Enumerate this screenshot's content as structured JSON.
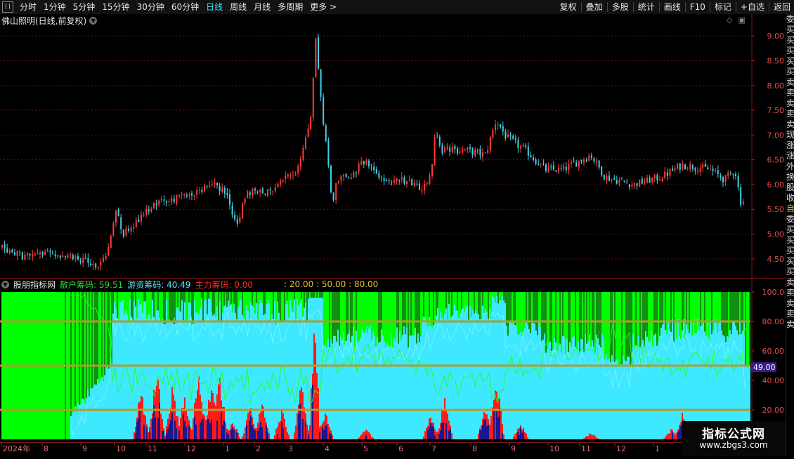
{
  "toolbar": {
    "left_items": [
      {
        "label": "分时",
        "active": false
      },
      {
        "label": "1分钟",
        "active": false
      },
      {
        "label": "5分钟",
        "active": false
      },
      {
        "label": "15分钟",
        "active": false
      },
      {
        "label": "30分钟",
        "active": false
      },
      {
        "label": "60分钟",
        "active": false
      },
      {
        "label": "日线",
        "active": true
      },
      {
        "label": "周线",
        "active": false
      },
      {
        "label": "月线",
        "active": false
      },
      {
        "label": "多周期",
        "active": false
      },
      {
        "label": "更多 >",
        "active": false
      }
    ],
    "right_items": [
      "复权",
      "叠加",
      "多股",
      "统计",
      "画线",
      "F10",
      "标记",
      "+自选",
      "返回"
    ]
  },
  "main_chart": {
    "title": "佛山照明(日线,前复权)",
    "icons": [
      "diamond-icon",
      "window-icon"
    ],
    "y_ticks": [
      "9.00",
      "8.50",
      "8.00",
      "7.50",
      "7.00",
      "6.50",
      "6.00",
      "5.50",
      "5.00",
      "4.50"
    ],
    "y_range": [
      4.2,
      9.3
    ],
    "up_color": "#ff3b3b",
    "down_color": "#3fd3e8"
  },
  "indicator": {
    "site_label": "股朋指标网",
    "retail": {
      "label": "散户筹码: 59.51",
      "color": "#27d63a"
    },
    "hot_money": {
      "label": "游资筹码: 40.49",
      "color": "#5be7ff"
    },
    "main_force": {
      "label": "主力筹码: 0.00",
      "color": "#ff2a2a"
    },
    "levels_label": ": 20.00 : 50.00 : 80.00",
    "y_ticks": [
      "100.0",
      "80.00",
      "60.00",
      "40.00",
      "20.00"
    ],
    "current_badge": "49.00",
    "y_range": [
      0,
      100
    ],
    "ref_lines": [
      20,
      50,
      80
    ],
    "colors": {
      "green": "#00ff00",
      "dark_green": "#119011",
      "cyan": "#3ee8ff",
      "blue": "#4e44c8",
      "navy": "#1a1790",
      "red": "#ff1a1a",
      "line": "#b59a2a"
    }
  },
  "date_axis": {
    "labels": [
      "2024年",
      "8",
      "9",
      "10",
      "11",
      "12",
      "1",
      "2",
      "3",
      "4",
      "5",
      "6",
      "7",
      "8",
      "9",
      "10",
      "11",
      "12",
      "1"
    ],
    "color": "#e07070"
  },
  "right_panel_chars": [
    "委",
    "买",
    "买",
    "买",
    "买",
    "买",
    "卖",
    "卖",
    "卖",
    "卖",
    "卖",
    "现",
    "涨",
    "涨",
    "外",
    "换",
    "股",
    "收",
    "",
    "自",
    "委",
    "买",
    "买",
    "买",
    "买",
    "买",
    "卖",
    "卖",
    "卖",
    "卖",
    "卖"
  ],
  "watermark": {
    "title": "指标公式网",
    "url": "www.zbgs3.com"
  }
}
